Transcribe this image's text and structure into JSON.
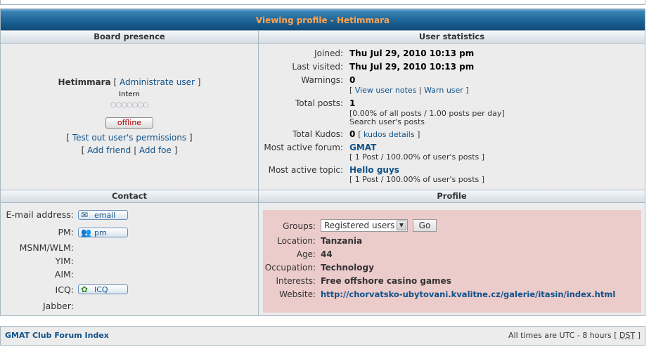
{
  "title": "Viewing profile - Hetimmara",
  "presence": {
    "header": "Board presence",
    "username": "Hetimmara",
    "admin_open": "[",
    "admin_link": "Administrate user",
    "admin_close": "]",
    "rank": "Intern",
    "rank_dots": "○○○○○○○",
    "status": "offline",
    "permissions_link": "Test out user's permissions",
    "add_friend": "Add friend",
    "add_foe": "Add foe"
  },
  "stats": {
    "header": "User statistics",
    "joined_label": "Joined:",
    "joined_value": "Thu Jul 29, 2010 10:13 pm",
    "visited_label": "Last visited:",
    "visited_value": "Thu Jul 29, 2010 10:13 pm",
    "warnings_label": "Warnings:",
    "warnings_value": "0",
    "view_notes": "View user notes",
    "warn_user": "Warn user",
    "posts_label": "Total posts:",
    "posts_value": "1",
    "posts_detail": "[0.00% of all posts / 1.00 posts per day]",
    "search_posts": "Search user's posts",
    "kudos_label": "Total Kudos:",
    "kudos_value": "0",
    "kudos_details": "kudos details",
    "forum_label": "Most active forum:",
    "forum_value": "GMAT",
    "forum_detail": "[ 1 Post / 100.00% of user's posts ]",
    "topic_label": "Most active topic:",
    "topic_value": "Hello guys",
    "topic_detail": "[ 1 Post / 100.00% of user's posts ]"
  },
  "contact": {
    "header": "Contact",
    "email_label": "E-mail address:",
    "email_button": "email",
    "pm_label": "PM:",
    "pm_button": "pm",
    "msnm_label": "MSNM/WLM:",
    "yim_label": "YIM:",
    "aim_label": "AIM:",
    "icq_label": "ICQ:",
    "icq_button": "ICQ",
    "jabber_label": "Jabber:"
  },
  "profile": {
    "header": "Profile",
    "groups_label": "Groups:",
    "groups_selected": "Registered users",
    "go_button": "Go",
    "location_label": "Location:",
    "location_value": "Tanzania",
    "age_label": "Age:",
    "age_value": "44",
    "occupation_label": "Occupation:",
    "occupation_value": "Technology",
    "interests_label": "Interests:",
    "interests_value": "Free offshore casino games",
    "website_label": "Website:",
    "website_value": "http://chorvatsko-ubytovani.kvalitne.cz/galerie/itasin/index.html"
  },
  "footer": {
    "index_link": "GMAT Club Forum Index",
    "timezone": "All times are UTC - 8 hours [",
    "dst": "DST",
    "timezone_close": "]"
  },
  "colors": {
    "title_text": "#ffa34f",
    "link": "#105289",
    "profile_bg": "#eccbcb",
    "offline_text": "#aa0000"
  }
}
